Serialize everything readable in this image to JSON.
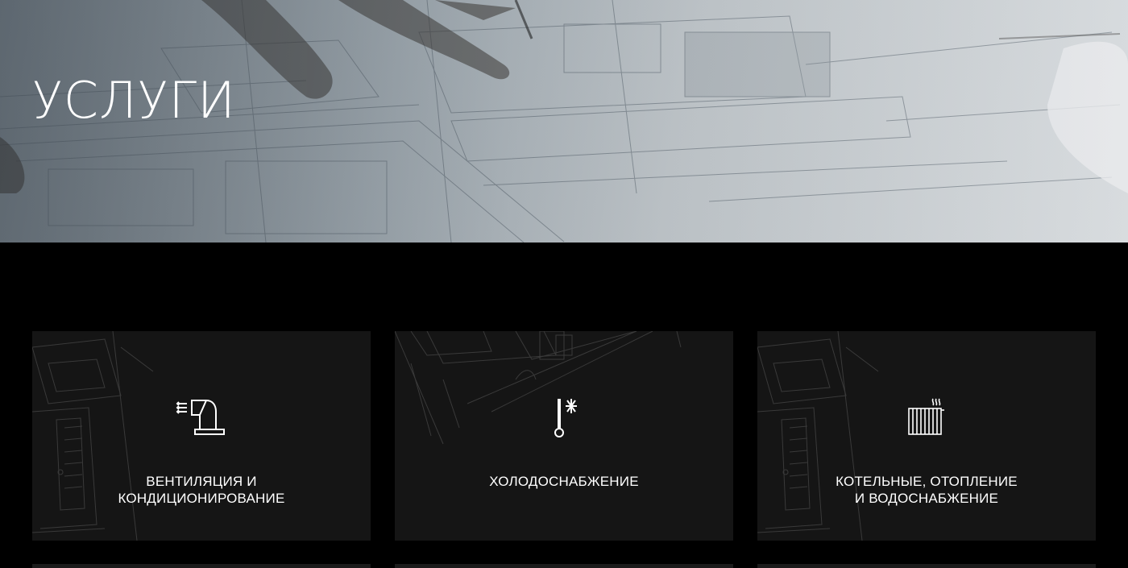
{
  "hero": {
    "title": "УСЛУГИ"
  },
  "services": [
    {
      "line1": "ВЕНТИЛЯЦИЯ И",
      "line2": "КОНДИЦИОНИРОВАНИЕ",
      "icon": "ventilation-duct-icon"
    },
    {
      "line1": "ХОЛОДОСНАБЖЕНИЕ",
      "line2": "",
      "icon": "thermometer-snowflake-icon"
    },
    {
      "line1": "КОТЕЛЬНЫЕ, ОТОПЛЕНИЕ",
      "line2": "И ВОДОСНАБЖЕНИЕ",
      "icon": "radiator-icon"
    }
  ],
  "colors": {
    "page_bg": "#000000",
    "card_bg": "#151515",
    "text": "#ffffff"
  }
}
